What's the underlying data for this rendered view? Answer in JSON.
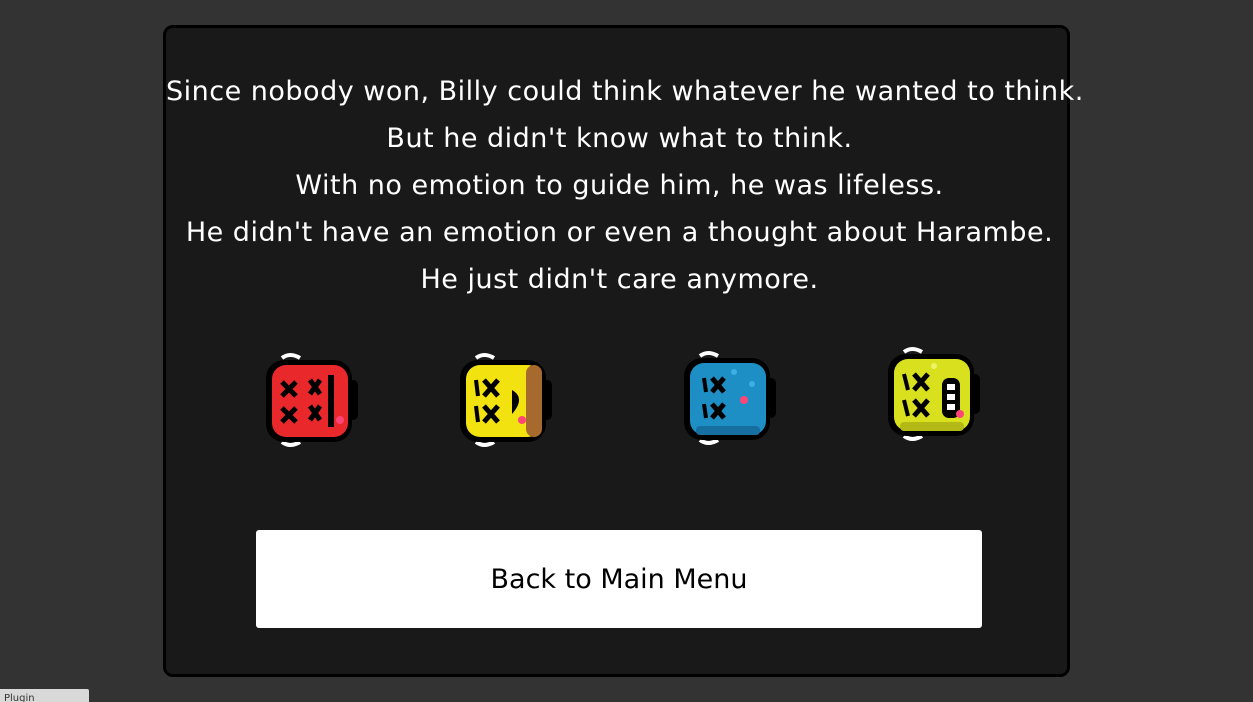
{
  "story": {
    "lines": [
      "Since nobody won, Billy could think whatever he wanted to think.",
      "But he didn't know what to think.",
      "With no emotion to guide him, he was lifeless.",
      "He didn't have an emotion or even a thought about Harambe.",
      "He just didn't care anymore."
    ]
  },
  "characters": [
    {
      "name": "red",
      "color": "#e8282b",
      "state": "knocked-out"
    },
    {
      "name": "yellow",
      "color": "#f2e20f",
      "state": "knocked-out"
    },
    {
      "name": "blue",
      "color": "#1d8fc4",
      "state": "knocked-out"
    },
    {
      "name": "lime",
      "color": "#d9e11e",
      "state": "knocked-out"
    }
  ],
  "menu": {
    "back_label": "Back to Main Menu"
  },
  "corner_tab": {
    "label": "Plugin"
  },
  "colors": {
    "background": "#333333",
    "panel": "#191919",
    "text": "#ffffff",
    "button": "#ffffff"
  }
}
